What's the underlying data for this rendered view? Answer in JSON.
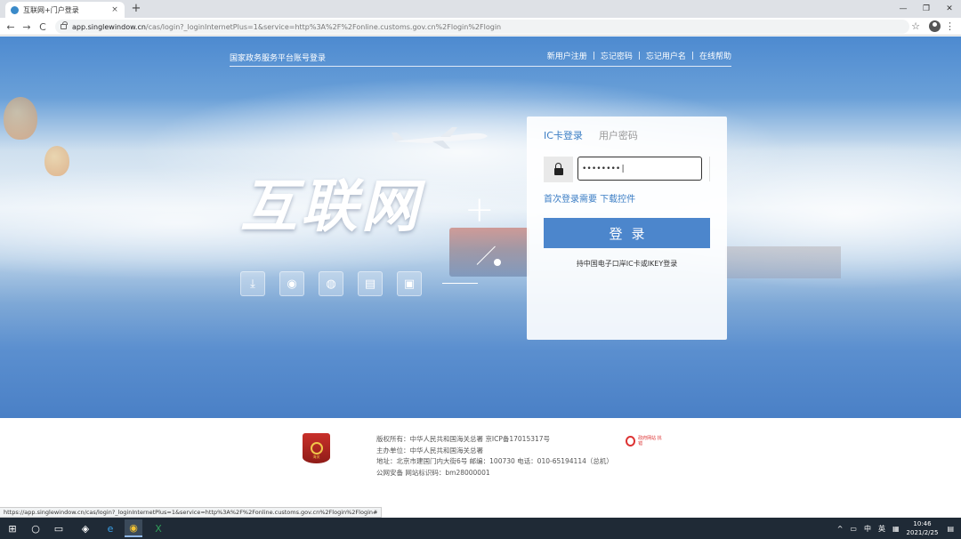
{
  "browser": {
    "tab_title": "互联网+门户登录",
    "tab_close": "×",
    "new_tab": "+",
    "back": "←",
    "forward": "→",
    "reload": "C",
    "url_host": "app.singlewindow.cn",
    "url_path": "/cas/login?_loginInternetPlus=1&service=http%3A%2F%2Fonline.customs.gov.cn%2Flogin%2Flogin",
    "star": "☆",
    "menu": "⋮",
    "minimize": "—",
    "maximize": "❐",
    "close": "✕"
  },
  "header": {
    "platform_title": "国家政务服务平台账号登录",
    "links": [
      "新用户注册",
      "忘记密码",
      "忘记用户名",
      "在线帮助"
    ],
    "separator": "|"
  },
  "hero": {
    "logo_text": "互联网",
    "logo_plus": "+",
    "feature_icons": [
      "download-icon",
      "wifi-icon",
      "globe-icon",
      "document-icon",
      "monitor-icon"
    ],
    "feature_glyphs": [
      "⤓",
      "◉",
      "◍",
      "▤",
      "▣"
    ]
  },
  "login": {
    "tab_ic": "IC卡登录",
    "tab_password": "用户密码",
    "password_value": "••••••••|",
    "first_login_link": "首次登录需要 下载控件",
    "submit_label": "登录",
    "note": "持中国电子口岸IC卡或IKEY登录"
  },
  "footer": {
    "emblem_label": "海关",
    "lines": [
      "版权所有：中华人民共和国海关总署 京ICP备17015317号",
      "主办单位：中华人民共和国海关总署",
      "地址：北京市建国门内大街6号 邮编：100730 电话：010-65194114（总机）",
      "公网安备 网站标识码：bm28000001"
    ],
    "gov_badge": "政府网站 找错"
  },
  "statusbar": {
    "url": "https://app.singlewindow.cn/cas/login?_loginInternetPlus=1&service=http%3A%2F%2Fonline.customs.gov.cn%2Flogin%2Flogin#"
  },
  "taskbar": {
    "ime": "英",
    "volume": "中",
    "time": "10:46",
    "date": "2021/2/25",
    "tray_caret": "^"
  },
  "colors": {
    "accent": "#4c86cc",
    "link": "#3b7dc4",
    "taskbar": "#1f2a36"
  }
}
